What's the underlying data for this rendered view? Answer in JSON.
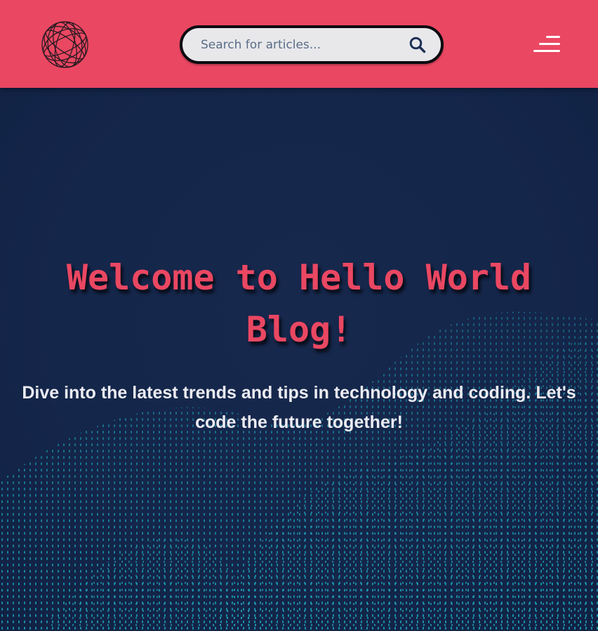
{
  "header": {
    "logo_icon": "wireframe-globe-icon",
    "search": {
      "placeholder": "Search for articles...",
      "value": "",
      "button_icon": "search-icon"
    },
    "menu_icon": "hamburger-menu-icon"
  },
  "hero": {
    "title": "Welcome to Hello World Blog!",
    "subtitle": "Dive into the latest trends and tips in technology and coding. Let's code the future together!",
    "background_icon": "particle-wave-icon"
  },
  "colors": {
    "header_background": "#ea4762",
    "hero_background": "#14264a",
    "accent": "#ea4762",
    "wave_particles": "#1ea3b8",
    "subtitle_text": "#ececf2"
  }
}
